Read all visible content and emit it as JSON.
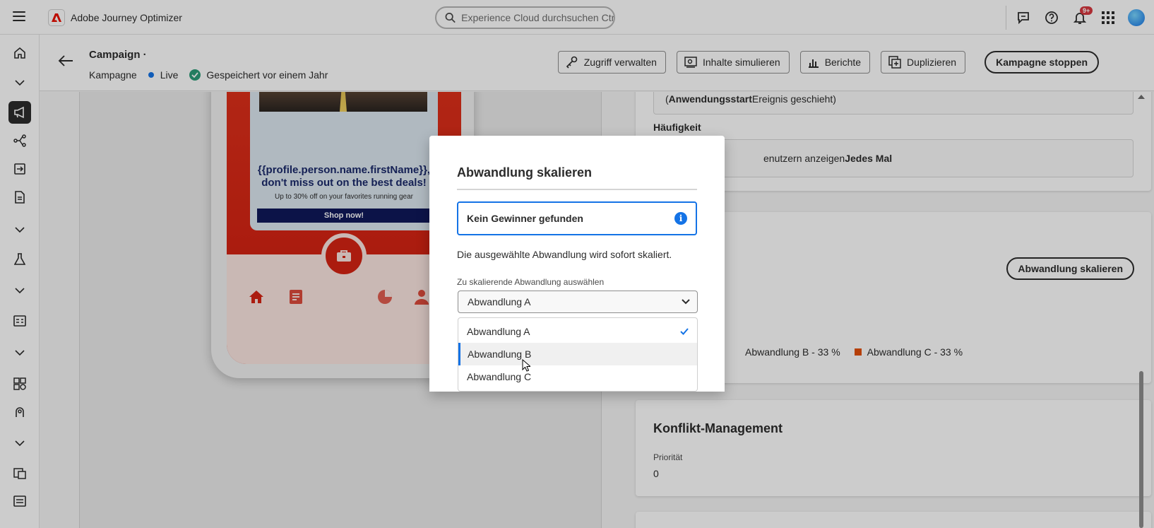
{
  "app": {
    "name": "Adobe Journey Optimizer"
  },
  "search": {
    "placeholder": "Experience Cloud durchsuchen Ctr..."
  },
  "notifications": {
    "badge": "9+"
  },
  "header": {
    "title": "Campaign ·",
    "type_label": "Kampagne",
    "status_label": "Live",
    "saved_label": "Gespeichert vor einem Jahr",
    "actions": {
      "access": "Zugriff verwalten",
      "simulate": "Inhalte simulieren",
      "reports": "Berichte",
      "duplicate": "Duplizieren",
      "stop": "Kampagne stoppen"
    }
  },
  "preview": {
    "headline": "{{profile.person.name.firstName}}, don't miss out on the best deals!",
    "subline": "Up to 30% off on your favorites running gear",
    "cta": "Shop now!"
  },
  "settings": {
    "trigger_open": "(",
    "trigger_bold": "Anwendungsstart",
    "trigger_rest": " Ereignis geschieht)",
    "frequency_label": "Häufigkeit",
    "frequency_text": "enutzern anzeigen ",
    "frequency_bold": "Jedes Mal",
    "scale_button": "Abwandlung skalieren",
    "legend": [
      {
        "label": "Abwandlung B - 33 %",
        "color": "#7f3e9c"
      },
      {
        "label": "Abwandlung C - 33 %",
        "color": "#e34f0a"
      }
    ],
    "conflict_title": "Konflikt-Management",
    "priority_label": "Priorität",
    "priority_value": "0"
  },
  "dialog": {
    "title": "Abwandlung skalieren",
    "info": "Kein Gewinner gefunden",
    "description": "Die ausgewählte Abwandlung wird sofort skaliert.",
    "field_label": "Zu skalierende Abwandlung auswählen",
    "selected": "Abwandlung A",
    "options": [
      "Abwandlung A",
      "Abwandlung B",
      "Abwandlung C"
    ]
  },
  "colors": {
    "accent": "#1473e6",
    "success": "#2d9d78",
    "brand_red": "#eb1000",
    "cta_navy": "#10185a"
  }
}
